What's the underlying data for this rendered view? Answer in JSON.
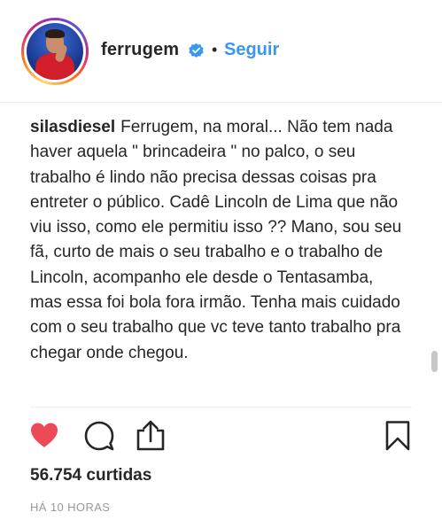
{
  "header": {
    "username": "ferrugem",
    "separator": "•",
    "follow_label": "Seguir"
  },
  "comment": {
    "author": "silasdiesel",
    "text": "Ferrugem, na moral... Não tem nada haver aquela \" brincadeira \" no palco, o seu trabalho é lindo não precisa dessas coisas pra entreter o público. Cadê Lincoln de Lima que não viu isso, como ele permitiu isso ?? Mano, sou seu fã, curto de mais o seu trabalho e o trabalho de Lincoln, acompanho ele desde o Tentasamba, mas essa foi bola fora irmão. Tenha mais cuidado com o seu trabalho que vc teve tanto trabalho pra chegar onde chegou."
  },
  "stats": {
    "likes": "56.754 curtidas",
    "time_ago": "HÁ 10 HORAS"
  },
  "icons": {
    "like": "heart-icon",
    "comment": "comment-bubble-icon",
    "share": "share-upload-icon",
    "save": "bookmark-icon",
    "verified": "verified-badge-icon"
  },
  "colors": {
    "like_active": "#ed4956",
    "follow": "#3897f0",
    "verified": "#3897f0",
    "muted": "#999999"
  }
}
